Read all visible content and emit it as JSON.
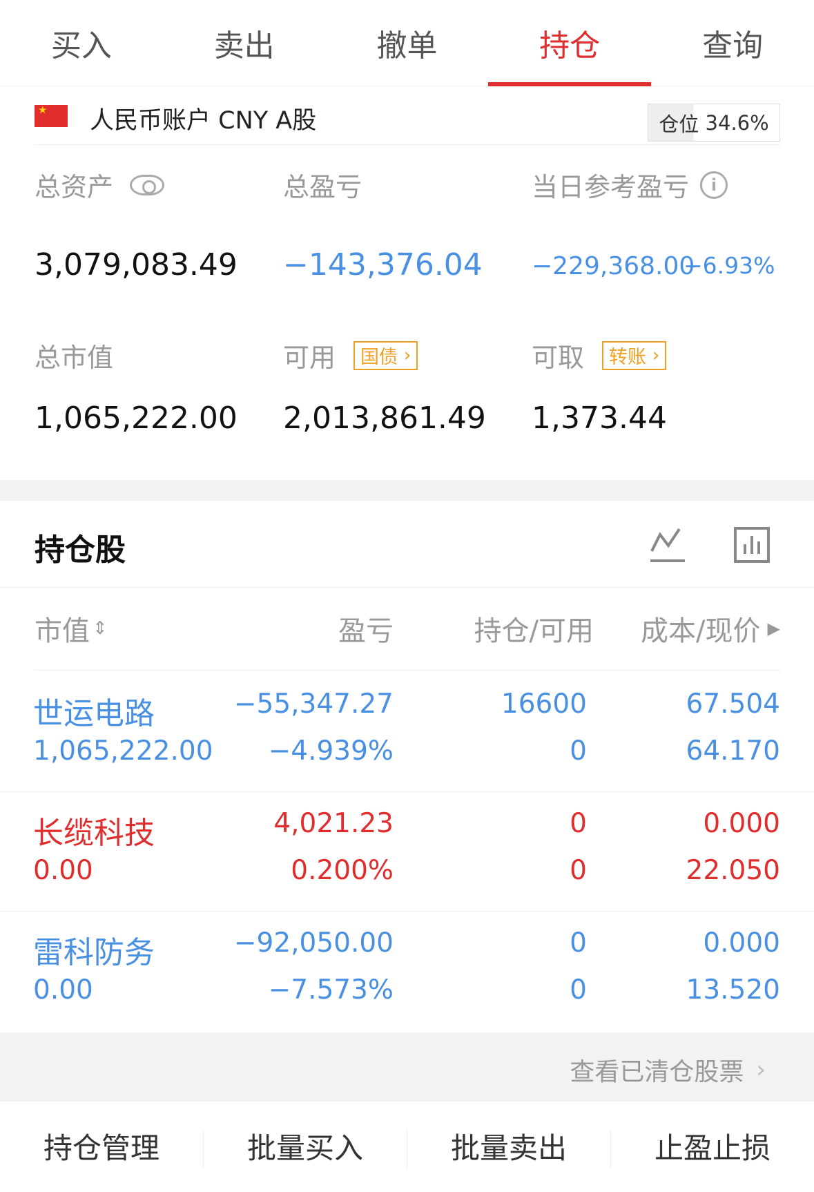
{
  "tabs": [
    {
      "label": "买入"
    },
    {
      "label": "卖出"
    },
    {
      "label": "撤单"
    },
    {
      "label": "持仓"
    },
    {
      "label": "查询"
    }
  ],
  "active_tab": "持仓",
  "account": {
    "name": "人民币账户 CNY A股",
    "position_label": "仓位",
    "position_value": "34.6%"
  },
  "summary": {
    "total_assets_label": "总资产",
    "total_assets": "3,079,083.49",
    "total_pl_label": "总盈亏",
    "total_pl": "−143,376.04",
    "daily_pl_label": "当日参考盈亏",
    "daily_pl": "−229,368.00",
    "daily_pl_pct": "−6.93%",
    "market_value_label": "总市值",
    "market_value": "1,065,222.00",
    "available_label": "可用",
    "available_tag": "国债",
    "available": "2,013,861.49",
    "withdrawable_label": "可取",
    "withdrawable_tag": "转账",
    "withdrawable": "1,373.44"
  },
  "holdings": {
    "title": "持仓股",
    "columns": [
      "市值",
      "盈亏",
      "持仓/可用",
      "成本/现价"
    ],
    "rows": [
      {
        "name": "世运电路",
        "market_value": "1,065,222.00",
        "pl": "−55,347.27",
        "pl_pct": "−4.939%",
        "hold": "16600",
        "avail": "0",
        "cost": "67.504",
        "price": "64.170",
        "color": "#4a90e2"
      },
      {
        "name": "长缆科技",
        "market_value": "0.00",
        "pl": "4,021.23",
        "pl_pct": "0.200%",
        "hold": "0",
        "avail": "0",
        "cost": "0.000",
        "price": "22.050",
        "color": "#e02d2d"
      },
      {
        "name": "雷科防务",
        "market_value": "0.00",
        "pl": "−92,050.00",
        "pl_pct": "−7.573%",
        "hold": "0",
        "avail": "0",
        "cost": "0.000",
        "price": "13.520",
        "color": "#4a90e2"
      }
    ]
  },
  "cleared_link": "查看已清仓股票",
  "bottom_actions": [
    {
      "label": "持仓管理"
    },
    {
      "label": "批量买入"
    },
    {
      "label": "批量卖出"
    },
    {
      "label": "止盈止损"
    }
  ]
}
